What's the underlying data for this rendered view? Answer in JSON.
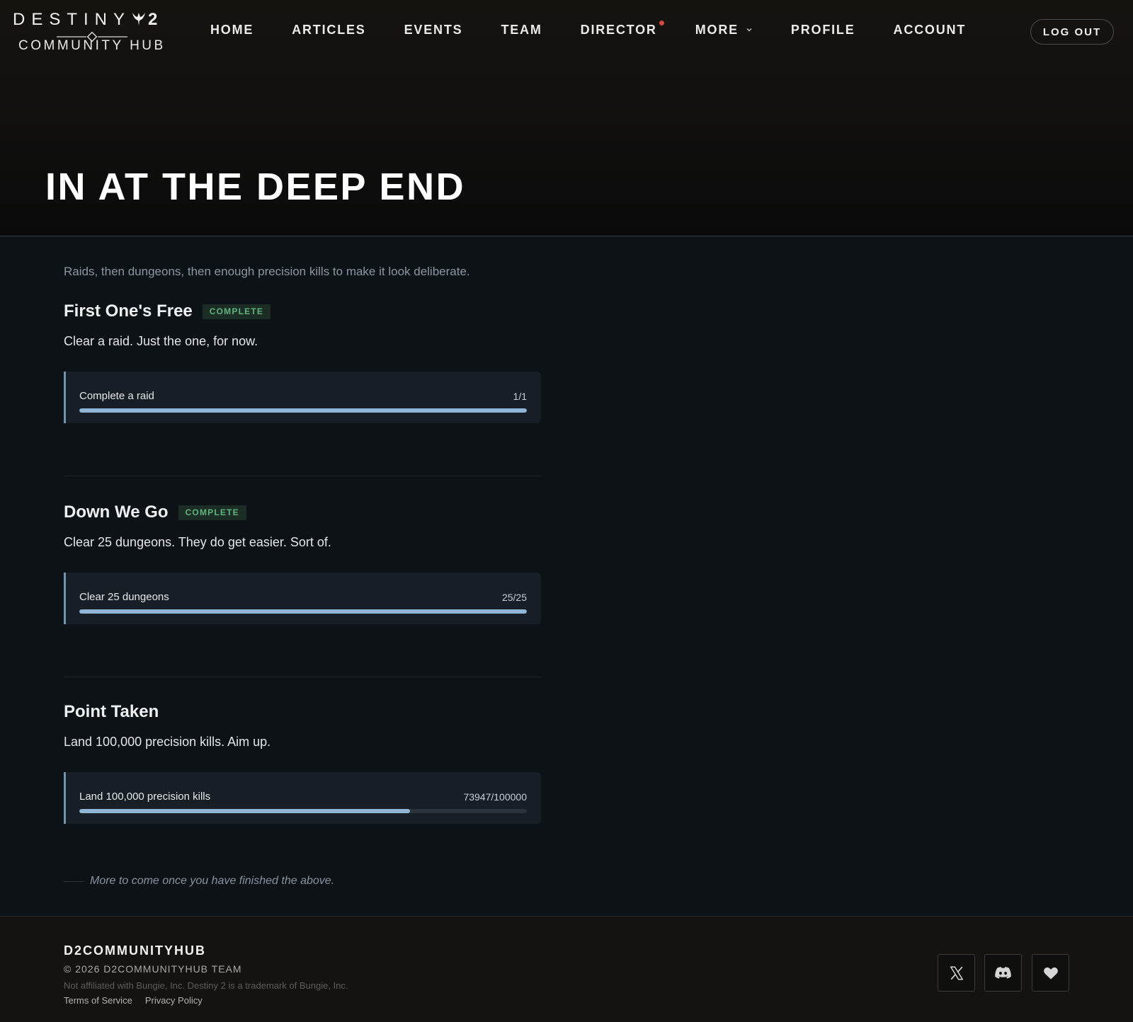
{
  "header": {
    "logo_top": "DESTINY",
    "logo_number": "2",
    "logo_bottom": "COMMUNITY HUB",
    "nav": [
      {
        "label": "HOME"
      },
      {
        "label": "ARTICLES"
      },
      {
        "label": "EVENTS"
      },
      {
        "label": "TEAM"
      },
      {
        "label": "DIRECTOR",
        "notification": true
      },
      {
        "label": "MORE",
        "has_dropdown": true
      },
      {
        "label": "PROFILE"
      },
      {
        "label": "ACCOUNT"
      }
    ],
    "logout_label": "LOG OUT"
  },
  "page": {
    "title": "IN AT THE DEEP END",
    "intro": "Raids, then dungeons, then enough precision kills to make it look deliberate."
  },
  "achievements": [
    {
      "title": "First One's Free",
      "badge": "COMPLETE",
      "description": "Clear a raid. Just the one, for now.",
      "objective": {
        "label": "Complete a raid",
        "count": "1/1",
        "progress": 1.0
      }
    },
    {
      "title": "Down We Go",
      "badge": "COMPLETE",
      "description": "Clear 25 dungeons. They do get easier. Sort of.",
      "objective": {
        "label": "Clear 25 dungeons",
        "count": "25/25",
        "progress": 1.0
      }
    },
    {
      "title": "Point Taken",
      "badge": "",
      "description": "Land 100,000 precision kills. Aim up.",
      "objective": {
        "label": "Land 100,000 precision kills",
        "count": "73947/100000",
        "progress": 0.73947
      }
    }
  ],
  "more_note": "More to come once you have finished the above.",
  "footer": {
    "brand": "D2COMMUNITYHUB",
    "copyright": "© 2026 D2COMMUNITYHUB TEAM",
    "disclaimer": "Not affiliated with Bungie, Inc. Destiny 2 is a trademark of Bungie, Inc.",
    "links": [
      "Terms of Service",
      "Privacy Policy"
    ],
    "social_icons": [
      "x-icon",
      "discord-icon",
      "heart-icon"
    ]
  },
  "colors": {
    "progress_fill": "#8fb6d6",
    "complete_badge_text": "#5fb57e",
    "notification_dot": "#d6483f"
  }
}
